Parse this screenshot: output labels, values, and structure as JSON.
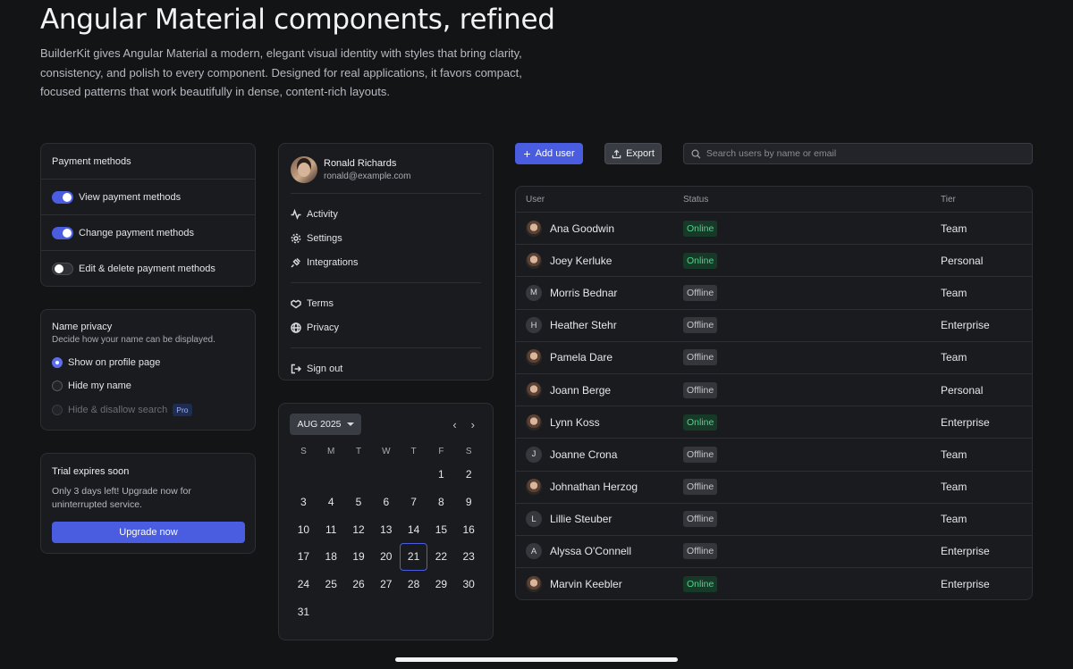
{
  "hero": {
    "title": "Angular Material components, refined",
    "description": "BuilderKit gives Angular Material a modern, elegant visual identity with styles that bring clarity, consistency, and polish to every component. Designed for real applications, it favors compact, focused patterns that work beautifully in dense, content-rich layouts."
  },
  "payment": {
    "title": "Payment methods",
    "items": [
      {
        "label": "View payment methods",
        "on": true
      },
      {
        "label": "Change payment methods",
        "on": true
      },
      {
        "label": "Edit & delete payment methods",
        "on": false
      }
    ]
  },
  "privacy": {
    "title": "Name privacy",
    "subtitle": "Decide how your name can be displayed.",
    "options": [
      {
        "label": "Show on profile page",
        "selected": true
      },
      {
        "label": "Hide my name",
        "selected": false
      },
      {
        "label": "Hide & disallow search",
        "selected": false,
        "disabled": true,
        "badge": "Pro"
      }
    ]
  },
  "trial": {
    "title": "Trial expires soon",
    "text": "Only 3 days left! Upgrade now for uninterrupted service.",
    "button": "Upgrade now"
  },
  "profile": {
    "name": "Ronald Richards",
    "email": "ronald@example.com",
    "menu": {
      "activity": "Activity",
      "settings": "Settings",
      "integrations": "Integrations",
      "terms": "Terms",
      "privacy": "Privacy",
      "signout": "Sign out"
    }
  },
  "calendar": {
    "month": "AUG 2025",
    "prev": "‹",
    "next": "›",
    "weekdays": [
      "S",
      "M",
      "T",
      "W",
      "T",
      "F",
      "S"
    ],
    "leading_blanks": 5,
    "days_in_month": 31,
    "selected_day": 21
  },
  "toolbar": {
    "add_label": "Add user",
    "export_label": "Export",
    "search_placeholder": "Search users by name or email"
  },
  "table": {
    "headers": {
      "user": "User",
      "status": "Status",
      "tier": "Tier"
    },
    "rows": [
      {
        "name": "Ana Goodwin",
        "avatar": "photo",
        "status": "Online",
        "tier": "Team"
      },
      {
        "name": "Joey Kerluke",
        "avatar": "photo",
        "status": "Online",
        "tier": "Personal"
      },
      {
        "name": "Morris Bednar",
        "avatar": "M",
        "status": "Offline",
        "tier": "Team"
      },
      {
        "name": "Heather Stehr",
        "avatar": "H",
        "status": "Offline",
        "tier": "Enterprise"
      },
      {
        "name": "Pamela Dare",
        "avatar": "photo",
        "status": "Offline",
        "tier": "Team"
      },
      {
        "name": "Joann Berge",
        "avatar": "photo",
        "status": "Offline",
        "tier": "Personal"
      },
      {
        "name": "Lynn Koss",
        "avatar": "photo",
        "status": "Online",
        "tier": "Enterprise"
      },
      {
        "name": "Joanne Crona",
        "avatar": "J",
        "status": "Offline",
        "tier": "Team"
      },
      {
        "name": "Johnathan Herzog",
        "avatar": "photo",
        "status": "Offline",
        "tier": "Team"
      },
      {
        "name": "Lillie Steuber",
        "avatar": "L",
        "status": "Offline",
        "tier": "Team"
      },
      {
        "name": "Alyssa O'Connell",
        "avatar": "A",
        "status": "Offline",
        "tier": "Enterprise"
      },
      {
        "name": "Marvin Keebler",
        "avatar": "photo",
        "status": "Online",
        "tier": "Enterprise"
      }
    ]
  },
  "colors": {
    "accent": "#4a5de0",
    "online": "#4ed38a",
    "background": "#131416"
  }
}
